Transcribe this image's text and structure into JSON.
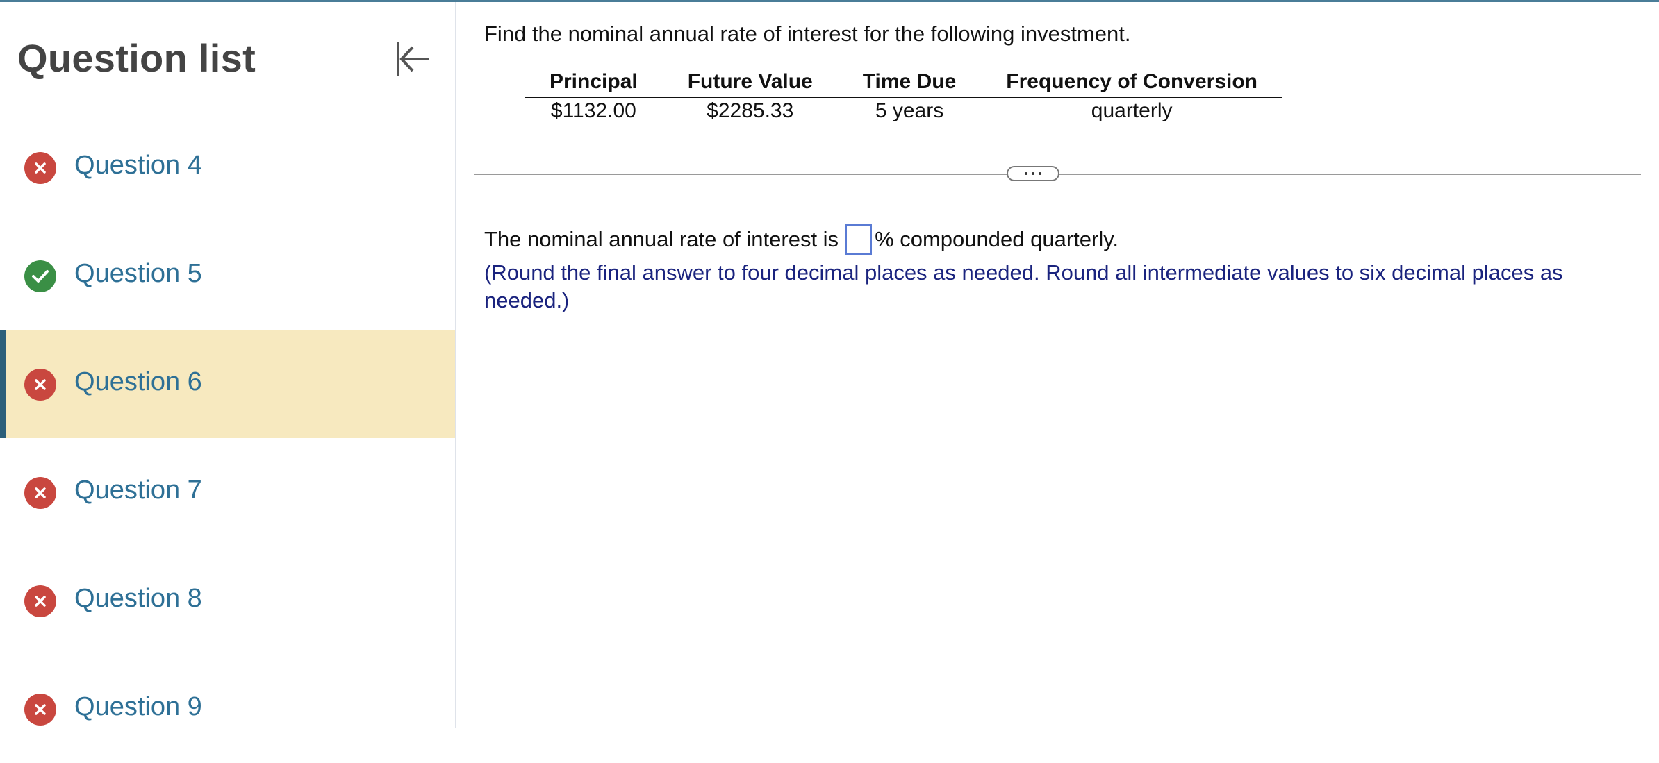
{
  "sidebar": {
    "title": "Question list",
    "collapse_icon": "collapse-left-icon",
    "items": [
      {
        "label": "Question 4",
        "status": "incorrect"
      },
      {
        "label": "Question 5",
        "status": "correct"
      },
      {
        "label": "Question 6",
        "status": "incorrect",
        "current": true
      },
      {
        "label": "Question 7",
        "status": "incorrect"
      },
      {
        "label": "Question 8",
        "status": "incorrect"
      },
      {
        "label": "Question 9",
        "status": "incorrect"
      }
    ]
  },
  "question": {
    "prompt": "Find the nominal annual rate of interest for the following investment.",
    "table": {
      "headers": [
        "Principal",
        "Future Value",
        "Time Due",
        "Frequency of Conversion"
      ],
      "row": [
        "$1132.00",
        "$2285.33",
        "5 years",
        "quarterly"
      ]
    },
    "answer_prefix": "The nominal annual rate of interest is",
    "answer_suffix": "% compounded quarterly.",
    "answer_value": "",
    "instructions": "(Round the final answer to four decimal places as needed. Round all intermediate values to six decimal places as needed.)"
  },
  "colors": {
    "accent": "#2e7096",
    "incorrect": "#c9473f",
    "correct": "#3a8f45",
    "current_highlight": "#f7e9bf",
    "instruction_text": "#1a237e"
  }
}
